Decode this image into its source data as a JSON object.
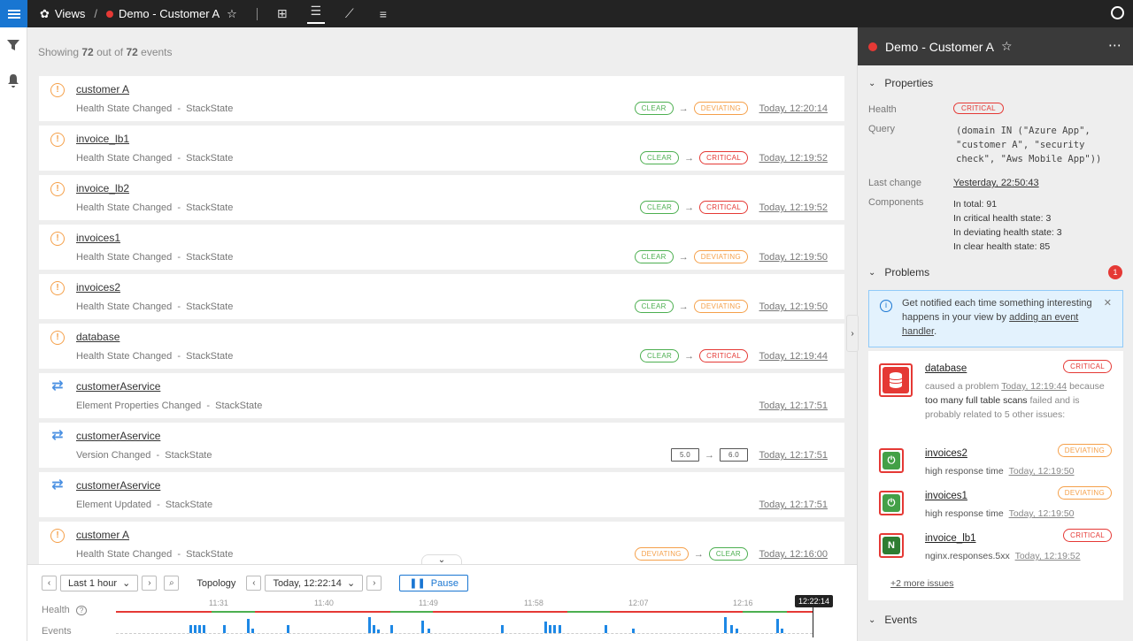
{
  "topbar": {
    "views_label": "Views",
    "view_name": "Demo - Customer A"
  },
  "summary": {
    "prefix": "Showing",
    "shown": "72",
    "mid": "out of",
    "total": "72",
    "suffix": "events"
  },
  "events": [
    {
      "type": "health",
      "title": "customer A",
      "subtitle": "Health State Changed  -  StackState",
      "from": "CLEAR",
      "to": "DEVIATING",
      "from_kind": "clear",
      "to_kind": "dev",
      "time": "Today, 12:20:14"
    },
    {
      "type": "health",
      "title": "invoice_lb1",
      "subtitle": "Health State Changed  -  StackState",
      "from": "CLEAR",
      "to": "CRITICAL",
      "from_kind": "clear",
      "to_kind": "crit",
      "time": "Today, 12:19:52"
    },
    {
      "type": "health",
      "title": "invoice_lb2",
      "subtitle": "Health State Changed  -  StackState",
      "from": "CLEAR",
      "to": "CRITICAL",
      "from_kind": "clear",
      "to_kind": "crit",
      "time": "Today, 12:19:52"
    },
    {
      "type": "health",
      "title": "invoices1",
      "subtitle": "Health State Changed  -  StackState",
      "from": "CLEAR",
      "to": "DEVIATING",
      "from_kind": "clear",
      "to_kind": "dev",
      "time": "Today, 12:19:50"
    },
    {
      "type": "health",
      "title": "invoices2",
      "subtitle": "Health State Changed  -  StackState",
      "from": "CLEAR",
      "to": "DEVIATING",
      "from_kind": "clear",
      "to_kind": "dev",
      "time": "Today, 12:19:50"
    },
    {
      "type": "health",
      "title": "database",
      "subtitle": "Health State Changed  -  StackState",
      "from": "CLEAR",
      "to": "CRITICAL",
      "from_kind": "clear",
      "to_kind": "crit",
      "time": "Today, 12:19:44"
    },
    {
      "type": "change",
      "title": "customerAservice",
      "subtitle": "Element Properties Changed  -  StackState",
      "from": "",
      "to": "",
      "from_kind": "",
      "to_kind": "",
      "time": "Today, 12:17:51"
    },
    {
      "type": "change",
      "title": "customerAservice",
      "subtitle": "Version Changed  -  StackState",
      "from": "5.0",
      "to": "6.0",
      "from_kind": "ver",
      "to_kind": "ver",
      "time": "Today, 12:17:51"
    },
    {
      "type": "change",
      "title": "customerAservice",
      "subtitle": "Element Updated  -  StackState",
      "from": "",
      "to": "",
      "from_kind": "",
      "to_kind": "",
      "time": "Today, 12:17:51"
    },
    {
      "type": "health",
      "title": "customer A",
      "subtitle": "Health State Changed  -  StackState",
      "from": "DEVIATING",
      "to": "CLEAR",
      "from_kind": "dev",
      "to_kind": "clear",
      "time": "Today, 12:16:00"
    }
  ],
  "timeline": {
    "range": "Last 1 hour",
    "topology_label": "Topology",
    "topology_time": "Today, 12:22:14",
    "pause_label": "Pause",
    "health_label": "Health",
    "events_label": "Events",
    "ticks": [
      "11:31",
      "11:40",
      "11:49",
      "11:58",
      "12:07",
      "12:16"
    ],
    "now": "12:22:14"
  },
  "panel": {
    "title": "Demo - Customer A",
    "properties_title": "Properties",
    "health_label": "Health",
    "health_value": "CRITICAL",
    "query_label": "Query",
    "query_lines": [
      "(domain IN (\"Azure App\",",
      "\"customer A\", \"security",
      "check\", \"Aws Mobile App\"))"
    ],
    "last_change_label": "Last change",
    "last_change_value": "Yesterday, 22:50:43",
    "components_label": "Components",
    "components": [
      "In total: 91",
      "In critical health state: 3",
      "In deviating health state: 3",
      "In clear health state: 85"
    ],
    "problems_title": "Problems",
    "problems_count": "1",
    "info_text_1": "Get notified each time something interesting happens in your view by",
    "info_link": "adding an event handler",
    "info_text_2": ".",
    "root": {
      "name": "database",
      "state": "CRITICAL",
      "caused": "caused a problem",
      "time": "Today, 12:19:44",
      "because": "because",
      "reason": "too many full table scans",
      "tail": "failed and is probably related to 5 other issues:"
    },
    "related": [
      {
        "name": "invoices2",
        "state": "DEVIATING",
        "kind": "dev",
        "desc": "high response time",
        "time": "Today, 12:19:50"
      },
      {
        "name": "invoices1",
        "state": "DEVIATING",
        "kind": "dev",
        "desc": "high response time",
        "time": "Today, 12:19:50"
      },
      {
        "name": "invoice_lb1",
        "state": "CRITICAL",
        "kind": "crit",
        "desc": "nginx.responses.5xx",
        "time": "Today, 12:19:52"
      }
    ],
    "more_issues": "+2 more issues",
    "events_title": "Events"
  },
  "colors": {
    "accent": "#1976d2",
    "critical": "#e53935",
    "deviating": "#f5a04a",
    "clear": "#4caf50"
  }
}
